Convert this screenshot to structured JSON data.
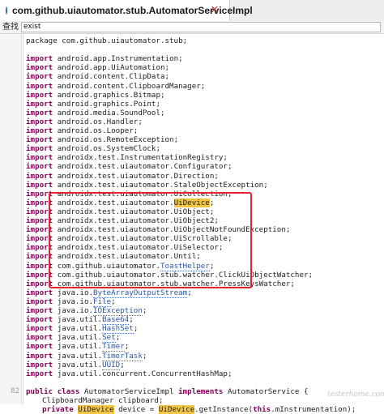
{
  "tab": {
    "title": "com.github.uiautomator.stub.AutomatorServiceImpl",
    "close_symbol": "✕"
  },
  "find": {
    "label": "查找",
    "value": "exist"
  },
  "code": {
    "line_number": "82",
    "package_line": "package com.github.uiautomator.stub;",
    "imports": [
      {
        "path": "android.app.Instrumentation;"
      },
      {
        "path": "android.app.UiAutomation;"
      },
      {
        "path": "android.content.ClipData;"
      },
      {
        "path": "android.content.ClipboardManager;"
      },
      {
        "path": "android.graphics.Bitmap;"
      },
      {
        "path": "android.graphics.Point;"
      },
      {
        "path": "android.media.SoundPool;"
      },
      {
        "path": "android.os.Handler;"
      },
      {
        "path": "android.os.Looper;"
      },
      {
        "path": "android.os.RemoteException;"
      },
      {
        "path": "android.os.SystemClock;"
      },
      {
        "path": "androidx.test.InstrumentationRegistry;"
      },
      {
        "path": "androidx.test.uiautomator.Configurator;"
      },
      {
        "path": "androidx.test.uiautomator.Direction;"
      },
      {
        "path": "androidx.test.uiautomator.StaleObjectException;"
      },
      {
        "path": "androidx.test.uiautomator.UiCollection;"
      },
      {
        "prefix": "androidx.test.uiautomator.",
        "highlight": "UiDevice",
        "suffix": ";"
      },
      {
        "path": "androidx.test.uiautomator.UiObject;"
      },
      {
        "path": "androidx.test.uiautomator.UiObject2;"
      },
      {
        "path": "androidx.test.uiautomator.UiObjectNotFoundException;"
      },
      {
        "path": "androidx.test.uiautomator.UiScrollable;"
      },
      {
        "path": "androidx.test.uiautomator.UiSelector;"
      },
      {
        "path": "androidx.test.uiautomator.Until;"
      },
      {
        "prefix": "com.github.uiautomator.",
        "underline": "ToastHelper",
        "suffix": ";"
      },
      {
        "path": "com.github.uiautomator.stub.watcher.ClickUiObjectWatcher;"
      },
      {
        "path": "com.github.uiautomator.stub.watcher.PressKeysWatcher;"
      },
      {
        "prefix": "java.io.",
        "underline": "ByteArrayOutputStream",
        "suffix": ";"
      },
      {
        "prefix": "java.io.",
        "underline": "File",
        "suffix": ";"
      },
      {
        "prefix": "java.io.",
        "underline": "IOException",
        "suffix": ";"
      },
      {
        "prefix": "java.util.",
        "underline": "Base64",
        "suffix": ";"
      },
      {
        "prefix": "java.util.",
        "underline": "HashSet",
        "suffix": ";"
      },
      {
        "prefix": "java.util.",
        "underline": "Set",
        "suffix": ";"
      },
      {
        "prefix": "java.util.",
        "underline": "Timer",
        "suffix": ";"
      },
      {
        "prefix": "java.util.",
        "underline": "TimerTask",
        "suffix": ";"
      },
      {
        "prefix": "java.util.",
        "underline": "UUID",
        "suffix": ";"
      },
      {
        "path": "java.util.concurrent.ConcurrentHashMap;"
      }
    ],
    "class_decl": {
      "kw1": "public class",
      "name": " AutomatorServiceImpl ",
      "kw2": "implements",
      "rest": " AutomatorService {"
    },
    "field_line": "ClipboardManager clipboard;",
    "last_line": {
      "kw": "private",
      "t1": " ",
      "hl1": "UiDevice",
      "t2": " device = ",
      "hl2": "UiDevice",
      "t3": ".getInstance(",
      "kw2": "this",
      "t4": ".mInstrumentation);"
    },
    "import_keyword": "import"
  },
  "watermark": "testerhome.com",
  "colors": {
    "keyword": "#7f0055",
    "highlight": "#f2c542",
    "annotation_box": "#e0262b"
  }
}
